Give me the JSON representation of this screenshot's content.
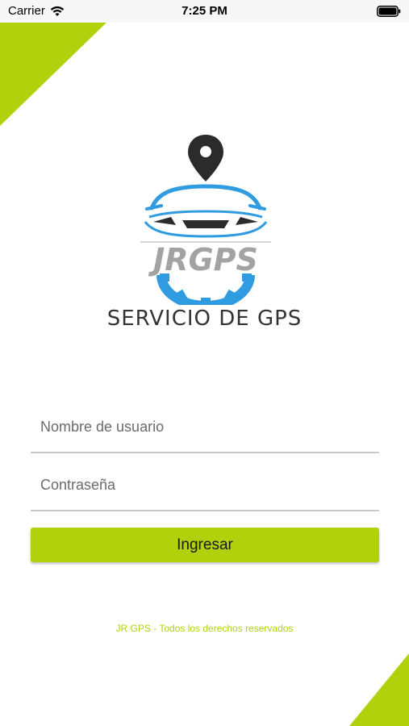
{
  "status_bar": {
    "carrier": "Carrier",
    "time": "7:25 PM",
    "wifi_icon": "wifi-icon",
    "battery_icon": "battery-icon"
  },
  "logo": {
    "brand": "JRGPS",
    "tagline": "SERVICIO DE GPS",
    "icons": [
      "location-pin-icon",
      "car-icon",
      "gear-icon"
    ]
  },
  "form": {
    "username_placeholder": "Nombre de usuario",
    "username_value": "",
    "password_placeholder": "Contraseña",
    "password_value": "",
    "submit_label": "Ingresar"
  },
  "footer": {
    "text": "JR GPS - Todos los derechos reservados"
  },
  "colors": {
    "accent": "#b2d10d",
    "logo_blue": "#2f9be0",
    "logo_dark": "#2b2b2b",
    "logo_gray": "#9a9a9a"
  }
}
